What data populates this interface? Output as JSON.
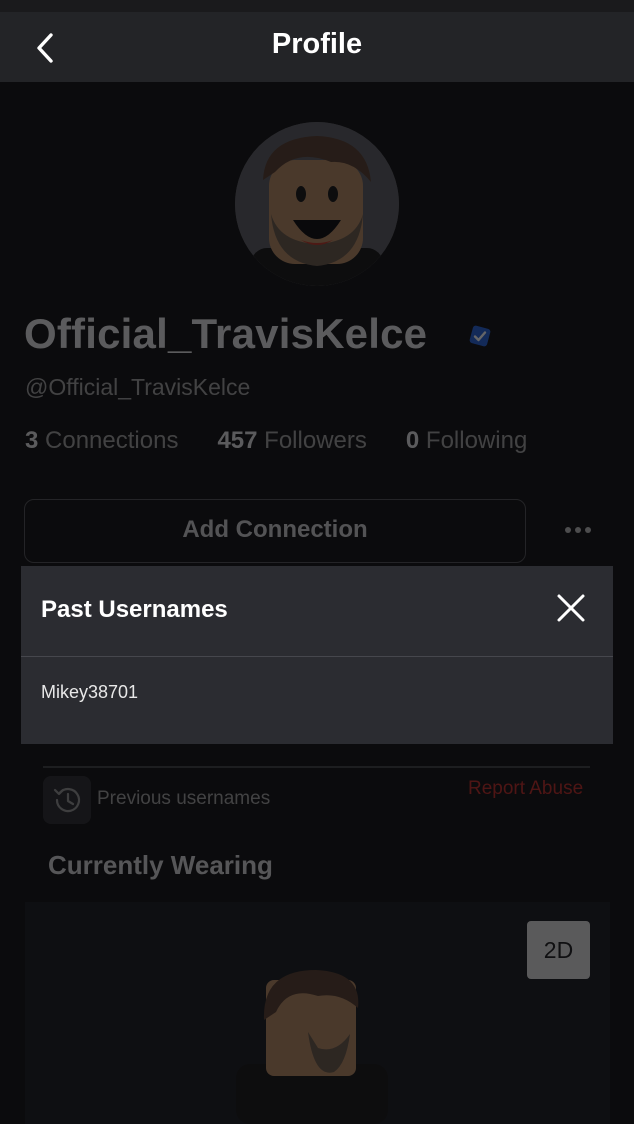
{
  "header": {
    "title": "Profile",
    "back_icon": "chevron-left-icon"
  },
  "profile": {
    "display_name": "Official_TravisKelce",
    "handle": "@Official_TravisKelce",
    "verified": true,
    "stats": [
      {
        "value": "3",
        "label": "Connections"
      },
      {
        "value": "457",
        "label": "Followers"
      },
      {
        "value": "0",
        "label": "Following"
      }
    ],
    "add_connection_label": "Add Connection",
    "more_icon": "ellipsis-icon"
  },
  "history": {
    "label": "Previous usernames",
    "icon": "history-icon"
  },
  "report_label": "Report Abuse",
  "wearing": {
    "title": "Currently Wearing",
    "toggle_label": "2D"
  },
  "modal": {
    "title": "Past Usernames",
    "close_icon": "close-icon",
    "usernames": [
      "Mikey38701"
    ]
  },
  "colors": {
    "background": "#121215",
    "topbar": "#232427",
    "modal": "#2b2c31",
    "report": "#c3302a",
    "verified": "#2a66d9"
  }
}
